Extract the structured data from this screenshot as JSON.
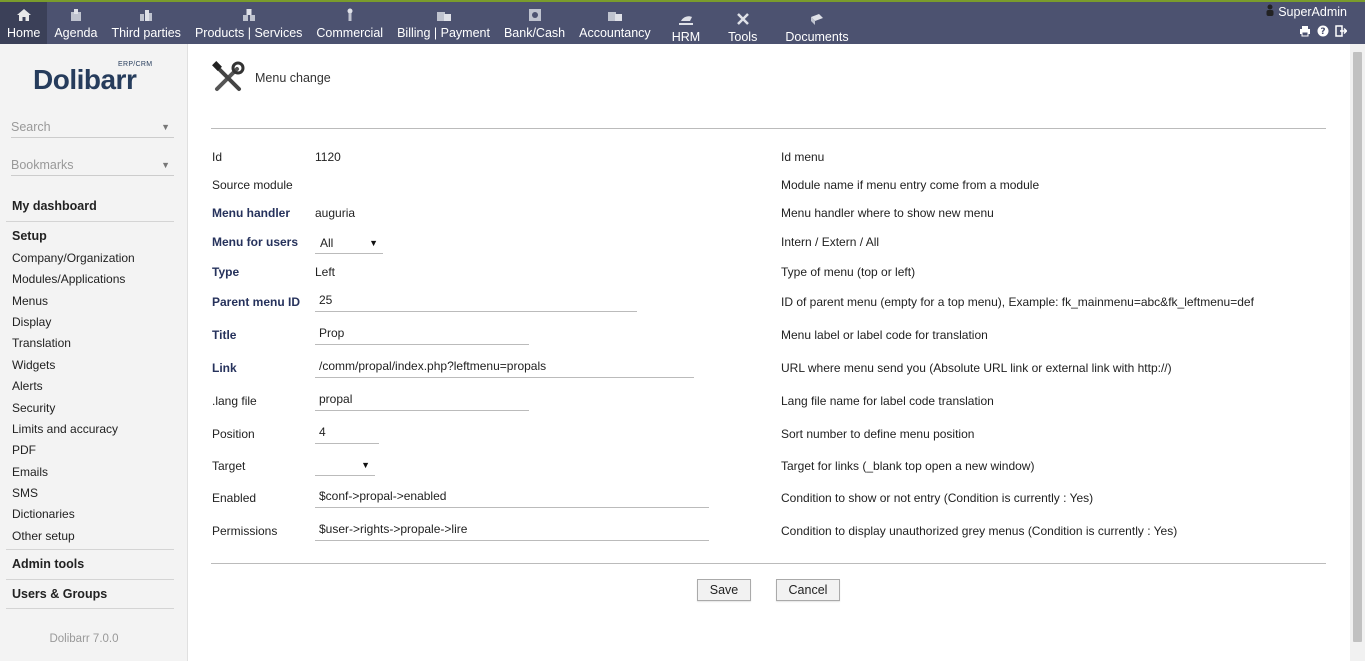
{
  "nav": {
    "items": [
      {
        "label": "Home",
        "icon": "home-icon"
      },
      {
        "label": "Agenda",
        "icon": "agenda-icon"
      },
      {
        "label": "Third parties",
        "icon": "third-parties-icon"
      },
      {
        "label": "Products | Services",
        "icon": "products-icon"
      },
      {
        "label": "Commercial",
        "icon": "commercial-icon"
      },
      {
        "label": "Billing | Payment",
        "icon": "billing-icon"
      },
      {
        "label": "Bank/Cash",
        "icon": "bank-icon"
      },
      {
        "label": "Accountancy",
        "icon": "accountancy-icon"
      },
      {
        "label": "HRM",
        "icon": "hrm-icon"
      },
      {
        "label": "Tools",
        "icon": "tools-icon"
      },
      {
        "label": "Documents",
        "icon": "documents-icon"
      }
    ],
    "active_index": 0
  },
  "user": {
    "name": "SuperAdmin"
  },
  "sidebar": {
    "logo": "Dolibarr",
    "logo_tag": "ERP/CRM",
    "search_placeholder": "Search",
    "bookmarks_placeholder": "Bookmarks",
    "my_dashboard": "My dashboard",
    "setup": "Setup",
    "setup_items": [
      "Company/Organization",
      "Modules/Applications",
      "Menus",
      "Display",
      "Translation",
      "Widgets",
      "Alerts",
      "Security",
      "Limits and accuracy",
      "PDF",
      "Emails",
      "SMS",
      "Dictionaries",
      "Other setup"
    ],
    "admin_tools": "Admin tools",
    "users_groups": "Users & Groups",
    "version": "Dolibarr 7.0.0"
  },
  "page": {
    "title": "Menu change"
  },
  "form": {
    "id": {
      "label": "Id",
      "value": "1120",
      "help": "Id menu"
    },
    "source_module": {
      "label": "Source module",
      "value": "",
      "help": "Module name if menu entry come from a module"
    },
    "menu_handler": {
      "label": "Menu handler",
      "value": "auguria",
      "help": "Menu handler where to show new menu"
    },
    "menu_for_users": {
      "label": "Menu for users",
      "value": "All",
      "help": "Intern / Extern / All"
    },
    "type": {
      "label": "Type",
      "value": "Left",
      "help": "Type of menu (top or left)"
    },
    "parent_menu_id": {
      "label": "Parent menu ID",
      "value": "25",
      "help": "ID of parent menu (empty for a top menu), Example: fk_mainmenu=abc&fk_leftmenu=def"
    },
    "title": {
      "label": "Title",
      "value": "Prop",
      "help": "Menu label or label code for translation"
    },
    "link": {
      "label": "Link",
      "value": "/comm/propal/index.php?leftmenu=propals",
      "help": "URL where menu send you (Absolute URL link or external link with http://)"
    },
    "lang_file": {
      "label": ".lang file",
      "value": "propal",
      "help": "Lang file name for label code translation"
    },
    "position": {
      "label": "Position",
      "value": "4",
      "help": "Sort number to define menu position"
    },
    "target": {
      "label": "Target",
      "value": "",
      "help": "Target for links (_blank top open a new window)"
    },
    "enabled": {
      "label": "Enabled",
      "value": "$conf->propal->enabled",
      "help": "Condition to show or not entry (Condition is currently : Yes)"
    },
    "permissions": {
      "label": "Permissions",
      "value": "$user->rights->propale->lire",
      "help": "Condition to display unauthorized grey menus (Condition is currently : Yes)"
    }
  },
  "buttons": {
    "save": "Save",
    "cancel": "Cancel"
  },
  "colors": {
    "topbar": "#4c5270",
    "accent_line": "#7a9c2c",
    "label_required": "#26325c"
  }
}
